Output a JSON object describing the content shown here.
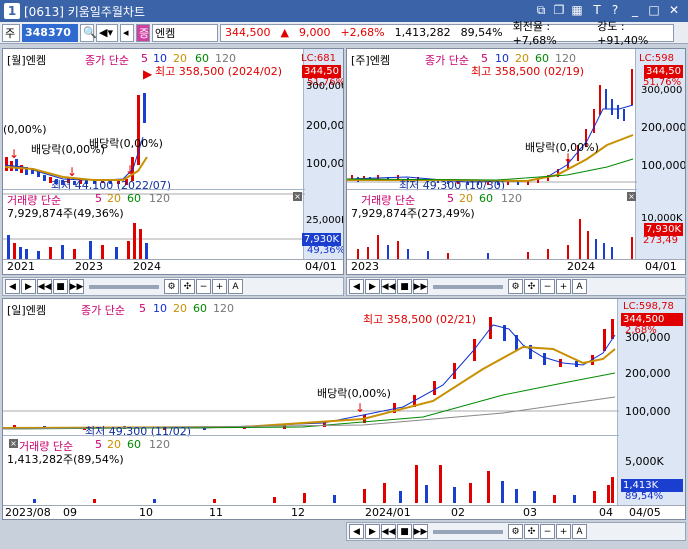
{
  "title": {
    "num": "1",
    "text": "[0613] 키움일주월차트"
  },
  "toolbar": {
    "market": "주",
    "code": "348370",
    "name": "엔켐",
    "price": "344,500",
    "change": "9,000",
    "rate": "+2,68%",
    "volume": "1,413,282",
    "vol_ratio": "89,54%",
    "turnover_label": "회전율 : +7,68%",
    "strength": "강도 : +91,40%"
  },
  "monthly": {
    "header": "[월]엔켐",
    "ma_label": "종가 단순",
    "ma": [
      "5",
      "10",
      "20",
      "60",
      "120"
    ],
    "high_label": "최고 358,500 (2024/02)",
    "low_label": "최저 44,100 (2022/07)",
    "div1": "(0,00%)",
    "div2": "배당락(0,00%)",
    "div3": "배당락(0,00%)",
    "lc": "LC:681",
    "price": "344,50",
    "pct": "51,76%",
    "y1": "300,000",
    "y2": "200,000",
    "y3": "100,000",
    "vol_header": "거래량 단순",
    "vol_ma": [
      "5",
      "20",
      "60",
      "120"
    ],
    "vol_value": "7,929,874주(49,36%)",
    "vol_y1": "25,000K",
    "vol_tag": "7,930K",
    "vol_pct": "49,36%",
    "dates": [
      "2021",
      "2023",
      "2024"
    ],
    "date_right": "04/01"
  },
  "weekly": {
    "header": "[주]엔켐",
    "ma_label": "종가 단순",
    "ma": [
      "5",
      "10",
      "20",
      "60",
      "120"
    ],
    "high_label": "최고 358,500 (02/19)",
    "low_label": "최저 49,300 (10/30)",
    "div": "배당락(0,00%)",
    "lc": "LC:598",
    "price": "344,50",
    "pct": "51,76%",
    "y1": "300,000",
    "y2": "200,000",
    "y3": "100,000",
    "vol_header": "거래량 단순",
    "vol_ma": [
      "5",
      "20",
      "60",
      "120"
    ],
    "vol_value": "7,929,874주(273,49%)",
    "vol_y1": "10,000K",
    "vol_tag": "7,930K",
    "vol_pct": "273,49",
    "dates": [
      "2023",
      "2024"
    ],
    "date_right": "04/01"
  },
  "daily": {
    "header": "[일]엔켐",
    "ma_label": "종가 단순",
    "ma": [
      "5",
      "10",
      "20",
      "60",
      "120"
    ],
    "high_label": "최고 358,500 (02/21)",
    "low_label": "최저 49,300 (11/02)",
    "div": "배당락(0,00%)",
    "lc": "LC:598,78",
    "price": "344,500",
    "pct": "2,68%",
    "y1": "300,000",
    "y2": "200,000",
    "y3": "100,000",
    "vol_header": "거래량 단순",
    "vol_ma": [
      "5",
      "20",
      "60",
      "120"
    ],
    "vol_value": "1,413,282주(89,54%)",
    "vol_y1": "5,000K",
    "vol_tag": "1,413K",
    "vol_pct": "89,54%",
    "dates": [
      "2023/08",
      "09",
      "10",
      "11",
      "12",
      "2024/01",
      "02",
      "03",
      "04"
    ],
    "date_right": "04/05"
  },
  "controls": {
    "a_label": "A",
    "plus": "+",
    "minus": "−"
  }
}
